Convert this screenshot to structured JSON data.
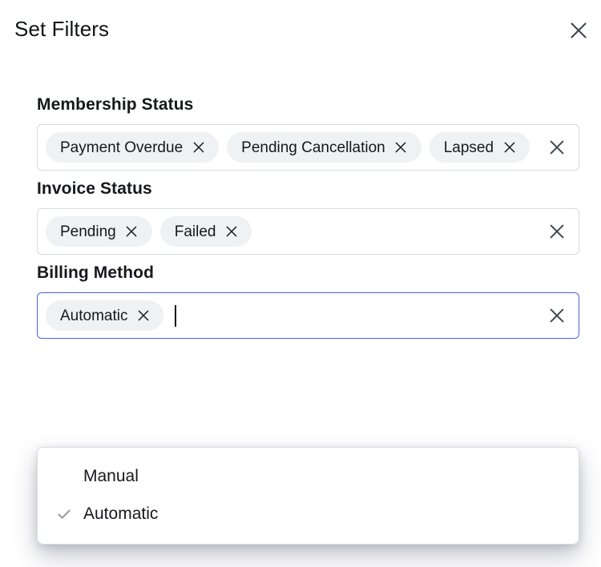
{
  "dialog": {
    "title": "Set Filters",
    "close_icon": "close-icon"
  },
  "colors": {
    "focus_border": "#4a62e0",
    "field_border": "#d8dade",
    "chip_background": "#f0f1f3",
    "text": "#16181b",
    "icon": "#3f444d",
    "check": "#9aa0a6"
  },
  "fields": [
    {
      "label": "Membership Status",
      "focused": false,
      "show_caret": false,
      "chips": [
        {
          "label": "Payment Overdue"
        },
        {
          "label": "Pending Cancellation"
        },
        {
          "label": "Lapsed"
        }
      ],
      "clear_icon": "clear-all-icon"
    },
    {
      "label": "Invoice Status",
      "focused": false,
      "show_caret": false,
      "chips": [
        {
          "label": "Pending"
        },
        {
          "label": "Failed"
        }
      ],
      "clear_icon": "clear-all-icon"
    },
    {
      "label": "Billing Method",
      "focused": true,
      "show_caret": true,
      "chips": [
        {
          "label": "Automatic"
        }
      ],
      "clear_icon": "clear-all-icon"
    }
  ],
  "dropdown": {
    "open": true,
    "belongs_to": "Billing Method",
    "options": [
      {
        "label": "Manual",
        "selected": false
      },
      {
        "label": "Automatic",
        "selected": true
      }
    ]
  }
}
